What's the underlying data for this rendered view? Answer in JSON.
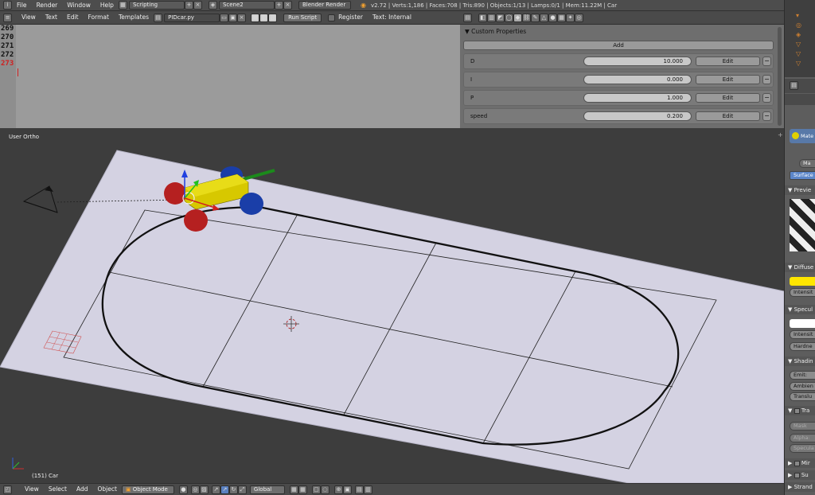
{
  "topbar": {
    "menus": [
      "File",
      "Render",
      "Window",
      "Help"
    ],
    "screen_layout": "Scripting",
    "scene": "Scene2",
    "render_engine": "Blender Render",
    "stats": "v2.72 | Verts:1,186 | Faces:708 | Tris:890 | Objects:1/13 | Lamps:0/1 | Mem:11.22M | Car"
  },
  "text_editor": {
    "menus": [
      "View",
      "Text",
      "Edit",
      "Format",
      "Templates"
    ],
    "filename": "PIDcar.py",
    "run_script": "Run Script",
    "register": "Register",
    "text_mode": "Text: Internal",
    "line_numbers": [
      "269",
      "270",
      "271",
      "272",
      "273"
    ]
  },
  "properties": {
    "section_title": "Custom Properties",
    "add_label": "Add",
    "items": [
      {
        "name": "D",
        "value": "10.000",
        "edit": "Edit",
        "remove": "−"
      },
      {
        "name": "I",
        "value": "0.000",
        "edit": "Edit",
        "remove": "−"
      },
      {
        "name": "P",
        "value": "1.000",
        "edit": "Edit",
        "remove": "−"
      },
      {
        "name": "speed",
        "value": "0.200",
        "edit": "Edit",
        "remove": "−"
      }
    ]
  },
  "viewport": {
    "view_label": "User Ortho",
    "object_label": "(151) Car"
  },
  "bottom_bar": {
    "menus": [
      "View",
      "Select",
      "Add",
      "Object"
    ],
    "mode": "Object Mode",
    "orientation": "Global"
  },
  "right_panel": {
    "material_tab": "Mate",
    "material_name": "Ma",
    "surface_tab": "Surface",
    "preview": "Previe",
    "diffuse": "Diffuse",
    "intensity": "Intensit",
    "specular": "Specul",
    "intensity2": "Intensit",
    "hardness": "Hardne",
    "shading": "Shadin",
    "emit": "Emit:",
    "ambient": "Ambien",
    "translucency": "Translu",
    "transparency": "Tra",
    "mask": "Mask",
    "alpha": "Alpha:",
    "specular2": "Specula",
    "mirror": "Mir",
    "sss": "Su",
    "strand": "Strand",
    "diffuse_color": "#ffe600"
  }
}
